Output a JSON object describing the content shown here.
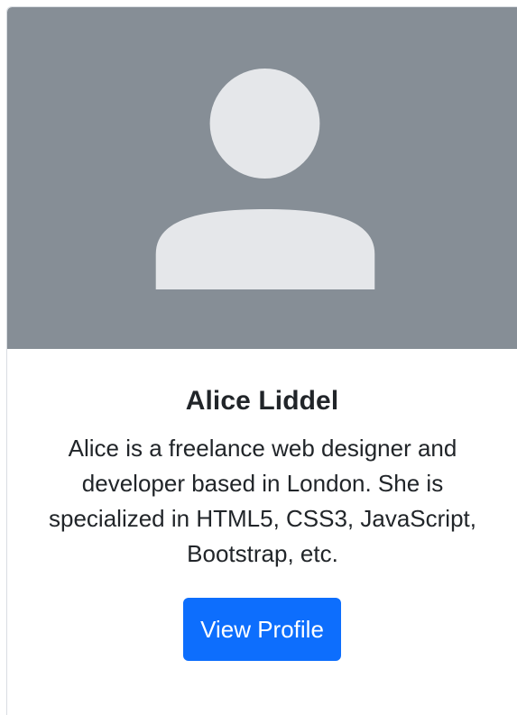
{
  "card": {
    "image": {
      "icon": "person-avatar-icon",
      "background_color": "#868e96",
      "icon_color": "#e5e7ea"
    },
    "title": "Alice Liddel",
    "text": "Alice is a freelance web designer and developer based in London. She is specialized in HTML5, CSS3, JavaScript, Bootstrap, etc.",
    "button_label": "View Profile",
    "button_color": "#0d6efd"
  }
}
